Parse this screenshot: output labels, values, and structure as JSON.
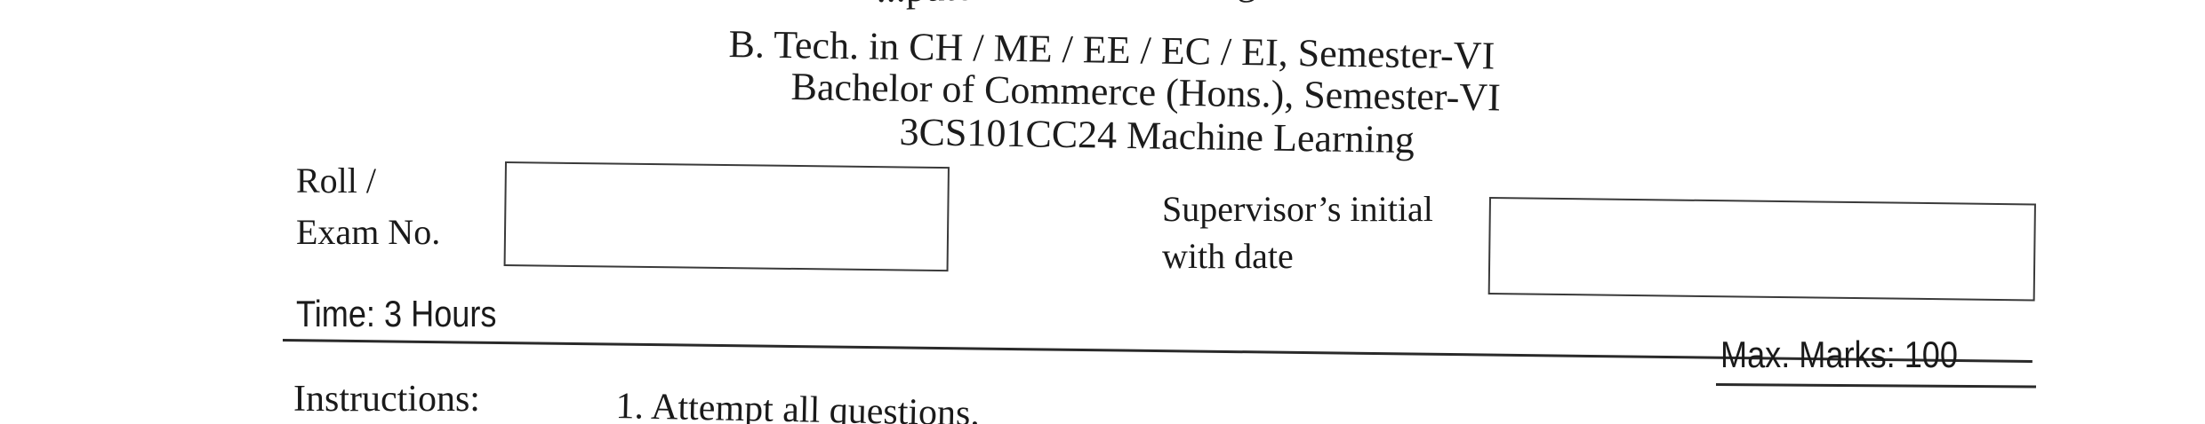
{
  "header": {
    "lines": [
      "...puter Science and Engineering, Semester-V",
      "B. Tech. in CH / ME / EE / EC / EI, Semester-VI",
      "Bachelor of Commerce (Hons.), Semester-VI",
      "3CS101CC24 Machine Learning"
    ]
  },
  "roll": {
    "label_line1": "Roll /",
    "label_line2": "Exam No.",
    "value": ""
  },
  "supervisor": {
    "label_line1": "Supervisor’s initial",
    "label_line2": "with date",
    "value": ""
  },
  "time": "Time: 3 Hours",
  "max_marks": "Max. Marks: 100",
  "instructions": {
    "label": "Instructions:",
    "items": [
      "1. Attempt all questions."
    ]
  }
}
